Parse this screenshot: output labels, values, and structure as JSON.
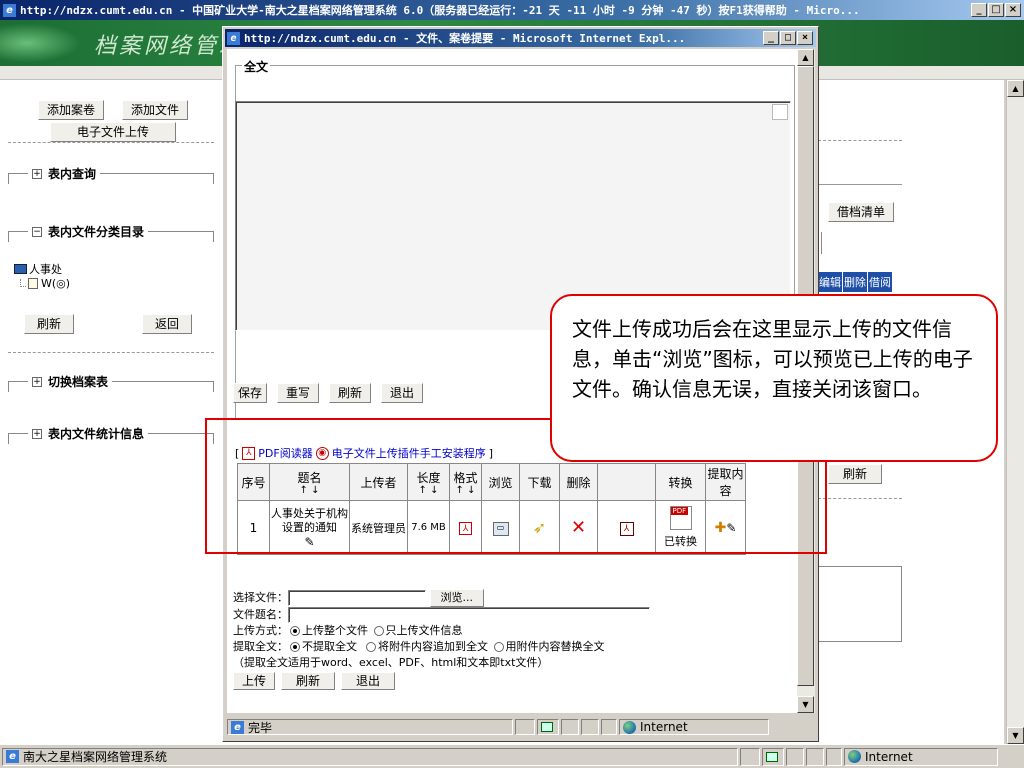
{
  "main_window": {
    "title": "http://ndzx.cumt.edu.cn - 中国矿业大学-南大之星档案网络管理系统 6.0（服务器已经运行：-21 天 -11 小时 -9 分钟 -47 秒）按F1获得帮助 - Micro...",
    "banner_text": "档案网络管理",
    "status_text": "南大之星档案网络管理系统",
    "zone": "Internet"
  },
  "sidebar": {
    "add_volume": "添加案卷",
    "add_file": "添加文件",
    "upload_e_file": "电子文件上传",
    "sections": {
      "query": "表内查询",
      "catalog": "表内文件分类目录",
      "switch": "切换档案表",
      "stats": "表内文件统计信息"
    },
    "tree_root": "人事处",
    "tree_child": "W(◎)",
    "refresh": "刷新",
    "back": "返回"
  },
  "right_panel": {
    "borrow_list": "借档清单",
    "edit": "编辑",
    "delete": "删除",
    "borrow": "借阅",
    "refresh": "刷新"
  },
  "popup": {
    "title": "http://ndzx.cumt.edu.cn - 文件、案卷提要 - Microsoft Internet Expl...",
    "fulltext_legend": "全文",
    "buttons": {
      "save": "保存",
      "rewrite": "重写",
      "refresh": "刷新",
      "exit": "退出"
    },
    "links": {
      "pdf_reader": "PDF阅读器",
      "plugin_install": "电子文件上传插件手工安装程序"
    },
    "table": {
      "headers": [
        "序号",
        "题名",
        "上传者",
        "长度",
        "格式",
        "浏览",
        "下载",
        "删除",
        "",
        "转换",
        "提取内容"
      ],
      "row": {
        "seq": "1",
        "title": "人事处关于机构设置的通知",
        "uploader": "系统管理员",
        "size": "7.6 MB",
        "converted": "已转换"
      }
    },
    "form": {
      "select_file": "选择文件：",
      "browse": "浏览...",
      "file_title": "文件题名：",
      "upload_mode": "上传方式：",
      "mode_whole": "上传整个文件",
      "mode_info": "只上传文件信息",
      "extract": "提取全文：",
      "extract_none": "不提取全文",
      "extract_append": "将附件内容追加到全文",
      "extract_replace": "用附件内容替换全文",
      "extract_note": "（提取全文适用于word、excel、PDF、html和文本即txt文件）",
      "upload": "上传",
      "refresh": "刷新",
      "exit": "退出"
    },
    "status_text": "完毕",
    "zone": "Internet"
  },
  "callout_text": "文件上传成功后会在这里显示上传的文件信息，单击“浏览”图标，可以预览已上传的电子文件。确认信息无误，直接关闭该窗口。"
}
